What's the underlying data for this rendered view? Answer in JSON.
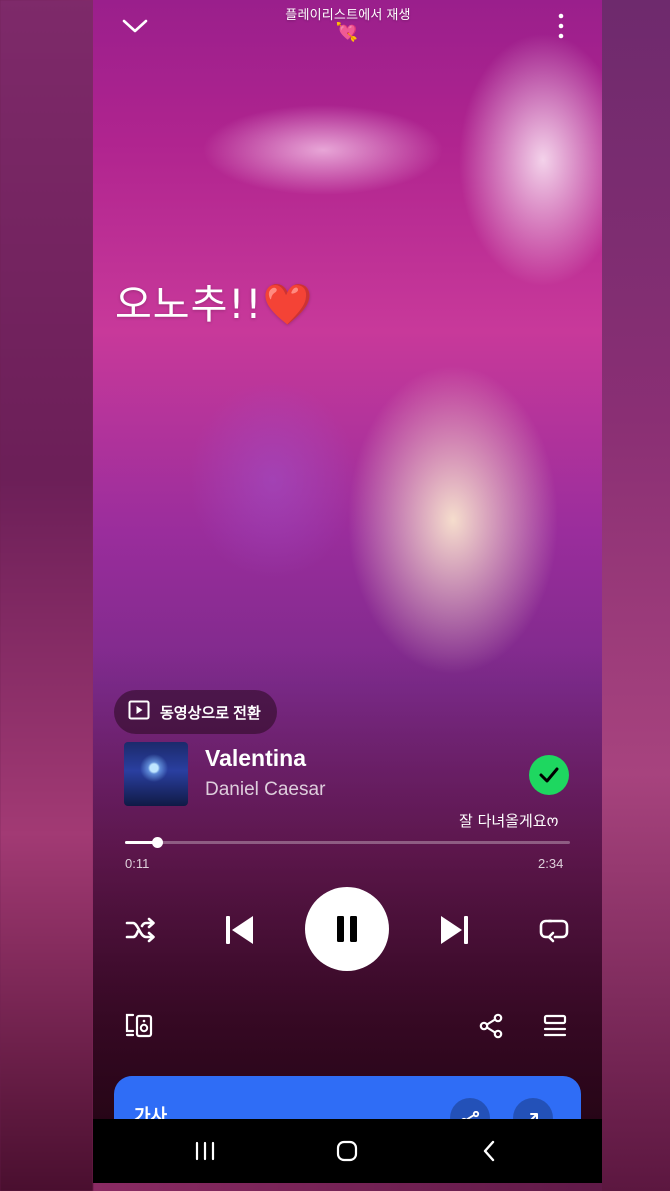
{
  "header": {
    "title": "플레이리스트에서 재생",
    "emoji": "💘",
    "close_icon": "chevron-down-icon",
    "more_icon": "more-vertical-icon"
  },
  "caption": "오노추!!❤️",
  "video_switch": {
    "label": "동영상으로 전환",
    "icon": "video-play-icon"
  },
  "track": {
    "title": "Valentina",
    "artist": "Daniel Caesar",
    "saved_icon": "check-circle-icon"
  },
  "overlay_text": "잘 다녀올게요ო",
  "progress": {
    "elapsed": "0:11",
    "total": "2:34",
    "fraction": 0.071
  },
  "controls": {
    "shuffle_icon": "shuffle-icon",
    "prev_icon": "skip-previous-icon",
    "play_state_icon": "pause-icon",
    "next_icon": "skip-next-icon",
    "repeat_icon": "repeat-icon"
  },
  "secondary_controls": {
    "devices_icon": "connect-device-icon",
    "share_icon": "share-icon",
    "queue_icon": "queue-icon"
  },
  "lyrics": {
    "label": "가사",
    "buttons": [
      "share-lyrics-icon",
      "expand-icon"
    ]
  },
  "system_nav": {
    "recents_icon": "recents-icon",
    "home_icon": "home-icon",
    "back_icon": "back-icon"
  },
  "colors": {
    "saved_green": "#1ed760",
    "lyrics_blue": "#2f6df6"
  }
}
